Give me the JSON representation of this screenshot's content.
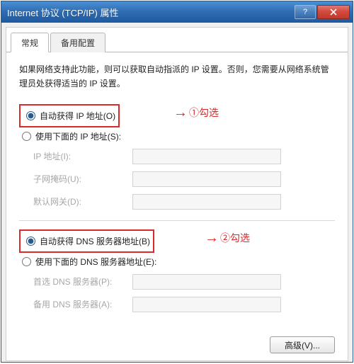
{
  "window": {
    "title": "Internet 协议 (TCP/IP) 属性"
  },
  "tabs": {
    "general": "常规",
    "alternate": "备用配置"
  },
  "description": "如果网络支持此功能，则可以获取自动指派的 IP 设置。否则，您需要从网络系统管理员处获得适当的 IP 设置。",
  "ip_group": {
    "auto": "自动获得 IP 地址(O)",
    "manual": "使用下面的 IP 地址(S):",
    "fields": {
      "ip": "IP 地址(I):",
      "mask": "子网掩码(U):",
      "gateway": "默认网关(D):"
    }
  },
  "dns_group": {
    "auto": "自动获得 DNS 服务器地址(B)",
    "manual": "使用下面的 DNS 服务器地址(E):",
    "fields": {
      "preferred": "首选 DNS 服务器(P):",
      "alternate": "备用 DNS 服务器(A):"
    }
  },
  "advanced_button": "高级(V)...",
  "annotations": {
    "one": "①勾选",
    "two": "②勾选"
  }
}
